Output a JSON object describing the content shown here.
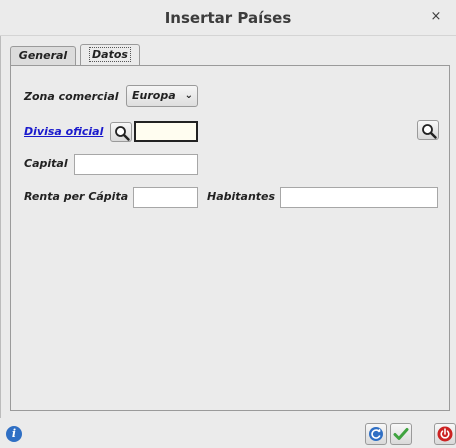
{
  "window": {
    "title": "Insertar Países",
    "close_glyph": "×"
  },
  "tabs": [
    {
      "label": "General",
      "active": false
    },
    {
      "label": "Datos",
      "active": true
    }
  ],
  "form": {
    "zona_comercial": {
      "label": "Zona comercial",
      "value": "Europa"
    },
    "divisa_oficial": {
      "label": "Divisa oficial",
      "value": ""
    },
    "capital": {
      "label": "Capital",
      "value": ""
    },
    "renta": {
      "label": "Renta per Cápita",
      "value": ""
    },
    "habitantes": {
      "label": "Habitantes",
      "value": ""
    }
  },
  "icons": {
    "search": "search-icon",
    "info": "info-icon",
    "refresh": "refresh-icon",
    "accept": "check-icon",
    "exit": "power-icon"
  },
  "colors": {
    "link": "#1a1acc",
    "info": "#2f6fc4",
    "accept": "#3fa33f",
    "exit": "#cc2222"
  }
}
